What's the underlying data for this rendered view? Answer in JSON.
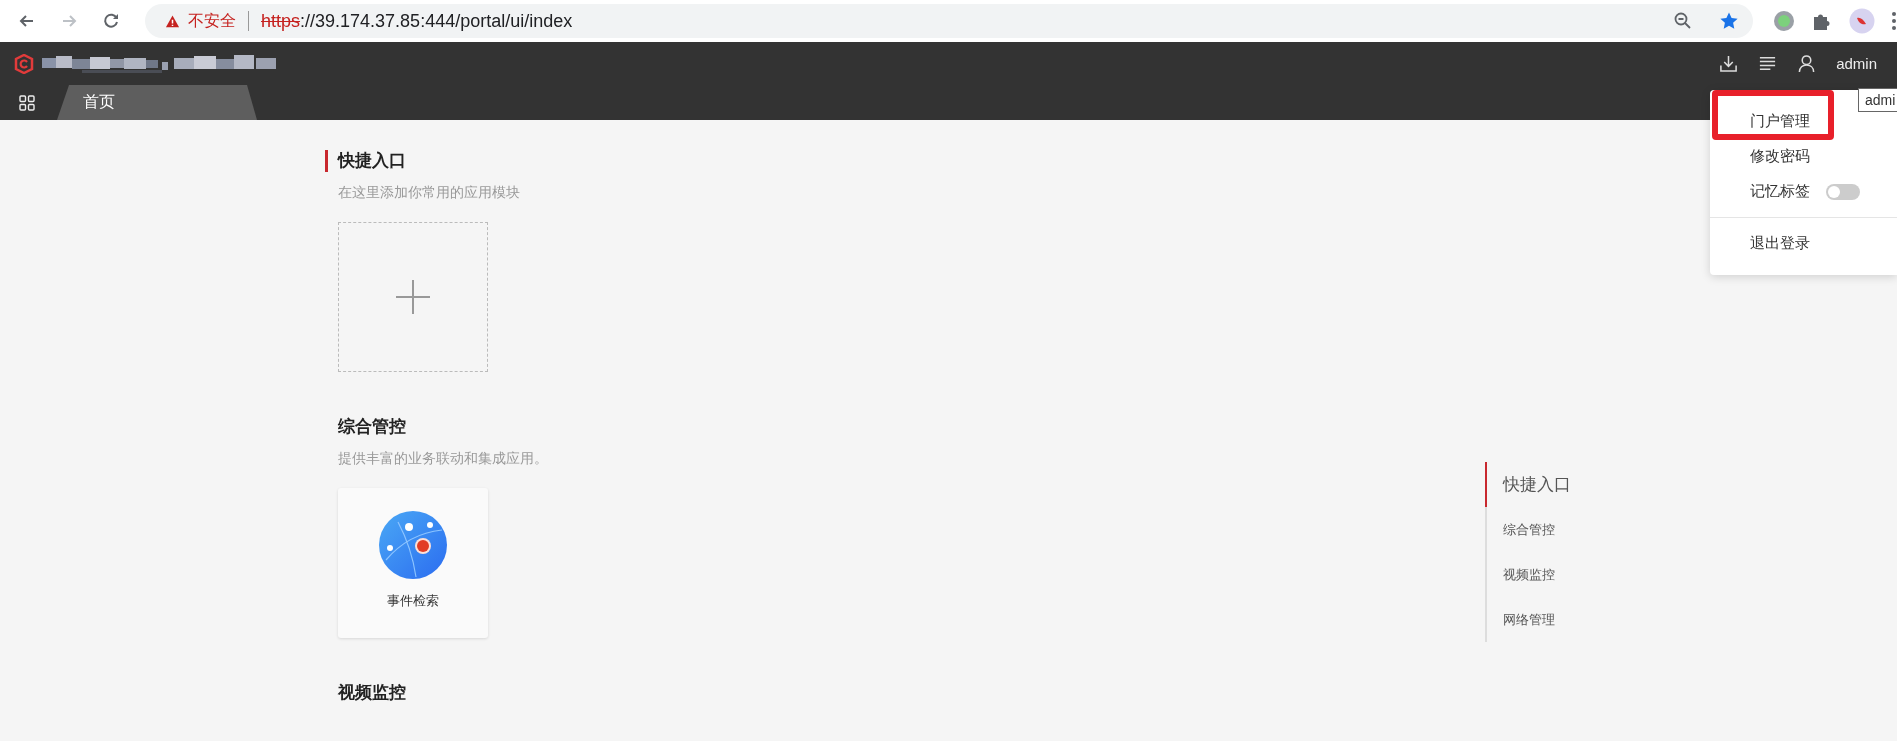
{
  "browser": {
    "security_label": "不安全",
    "url_scheme": "https",
    "url_rest": "://39.174.37.85:444/portal/ui/index"
  },
  "header": {
    "username": "admin",
    "tooltip": "admi"
  },
  "tabs": [
    {
      "label": "首页",
      "selected": true
    }
  ],
  "sections": [
    {
      "title": "快捷入口",
      "accent": true,
      "description": "在这里添加你常用的应用模块",
      "tiles": [
        {
          "kind": "add"
        }
      ]
    },
    {
      "title": "综合管控",
      "accent": false,
      "description": "提供丰富的业务联动和集成应用。",
      "tiles": [
        {
          "kind": "app",
          "label": "事件检索"
        }
      ]
    },
    {
      "title": "视频监控",
      "accent": false
    }
  ],
  "anchor_nav": [
    {
      "label": "快捷入口",
      "selected": true
    },
    {
      "label": "综合管控",
      "selected": false
    },
    {
      "label": "视频监控",
      "selected": false
    },
    {
      "label": "网络管理",
      "selected": false
    }
  ],
  "user_menu": [
    {
      "kind": "link",
      "label": "门户管理",
      "highlighted": true
    },
    {
      "kind": "link",
      "label": "修改密码",
      "highlighted": false
    },
    {
      "kind": "toggle",
      "label": "记忆标签",
      "on": false
    },
    {
      "kind": "divider"
    },
    {
      "kind": "link",
      "label": "退出登录",
      "highlighted": false
    }
  ]
}
